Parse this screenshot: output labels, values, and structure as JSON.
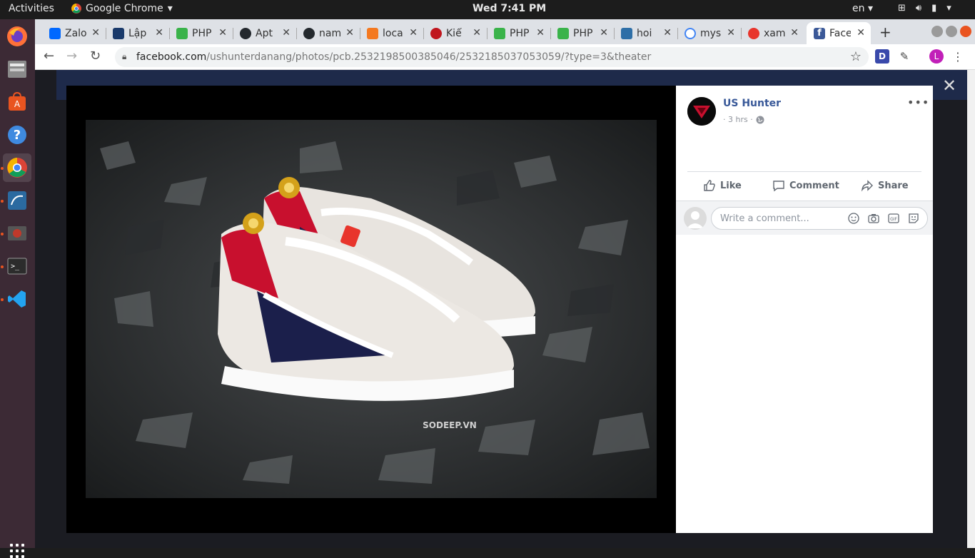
{
  "os": {
    "activities": "Activities",
    "app_name": "Google Chrome",
    "clock": "Wed  7:41 PM",
    "lang": "en"
  },
  "tabs": [
    {
      "label": "Zalo",
      "color": "#0068ff"
    },
    {
      "label": "Lập",
      "color": "#1a3a6b"
    },
    {
      "label": "PHP",
      "color": "#3ab34a"
    },
    {
      "label": "Apt",
      "color": "#24292e"
    },
    {
      "label": "nam",
      "color": "#24292e"
    },
    {
      "label": "loca",
      "color": "#f47920"
    },
    {
      "label": "Kiể",
      "color": "#c0161e"
    },
    {
      "label": "PHP",
      "color": "#3ab34a"
    },
    {
      "label": "PHP",
      "color": "#3ab34a"
    },
    {
      "label": "hoi",
      "color": "#2e6fa7"
    },
    {
      "label": "mys",
      "color": "#4285f4"
    },
    {
      "label": "xam",
      "color": "#e8352c"
    },
    {
      "label": "Face",
      "color": "#3b5998"
    }
  ],
  "url": {
    "domain": "facebook.com",
    "path": "/ushunterdanang/photos/pcb.2532198500385046/2532185037053059/?type=3&theater"
  },
  "extensions": {
    "d_label": "D",
    "profile_initial": "L"
  },
  "post": {
    "author": "US Hunter",
    "time": "· 3 hrs ·",
    "like": "Like",
    "comment": "Comment",
    "share": "Share",
    "comment_placeholder": "Write a comment..."
  },
  "photo": {
    "watermark": "SODEEP.VN"
  },
  "colors": {
    "facebook_link": "#385898",
    "ubuntu_accent": "#e95420"
  }
}
